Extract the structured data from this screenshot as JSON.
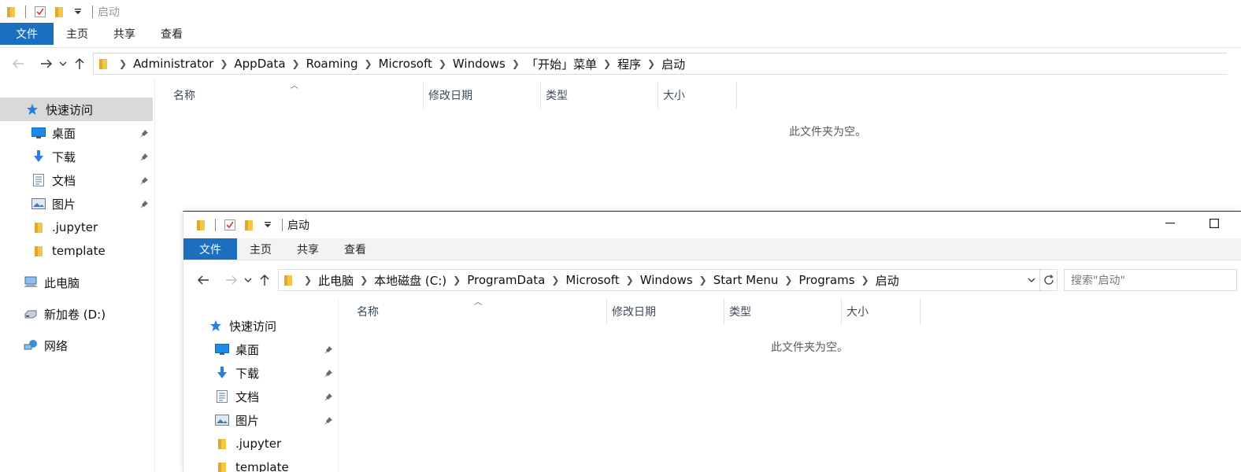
{
  "back_window": {
    "title": "启动",
    "ribbon_tabs": [
      "文件",
      "主页",
      "共享",
      "查看"
    ],
    "breadcrumb": [
      "Administrator",
      "AppData",
      "Roaming",
      "Microsoft",
      "Windows",
      "「开始」菜单",
      "程序",
      "启动"
    ],
    "columns": [
      "名称",
      "修改日期",
      "类型",
      "大小"
    ],
    "empty_message": "此文件夹为空。",
    "nav": {
      "quick_access": "快速访问",
      "pinned": [
        "桌面",
        "下载",
        "文档",
        "图片"
      ],
      "folders": [
        ".jupyter",
        "template"
      ],
      "this_pc": "此电脑",
      "drive": "新加卷 (D:)",
      "network": "网络"
    }
  },
  "front_window": {
    "title": "启动",
    "ribbon_tabs": [
      "文件",
      "主页",
      "共享",
      "查看"
    ],
    "breadcrumb": [
      "此电脑",
      "本地磁盘 (C:)",
      "ProgramData",
      "Microsoft",
      "Windows",
      "Start Menu",
      "Programs",
      "启动"
    ],
    "search_placeholder": "搜索\"启动\"",
    "columns": [
      "名称",
      "修改日期",
      "类型",
      "大小"
    ],
    "empty_message": "此文件夹为空。",
    "nav": {
      "quick_access": "快速访问",
      "pinned": [
        "桌面",
        "下载",
        "文档",
        "图片"
      ],
      "folders": [
        ".jupyter",
        "template"
      ]
    }
  },
  "colors": {
    "accent": "#1a6fbf",
    "selected_nav": "#d9d9d9",
    "folder": "#f2c744"
  }
}
